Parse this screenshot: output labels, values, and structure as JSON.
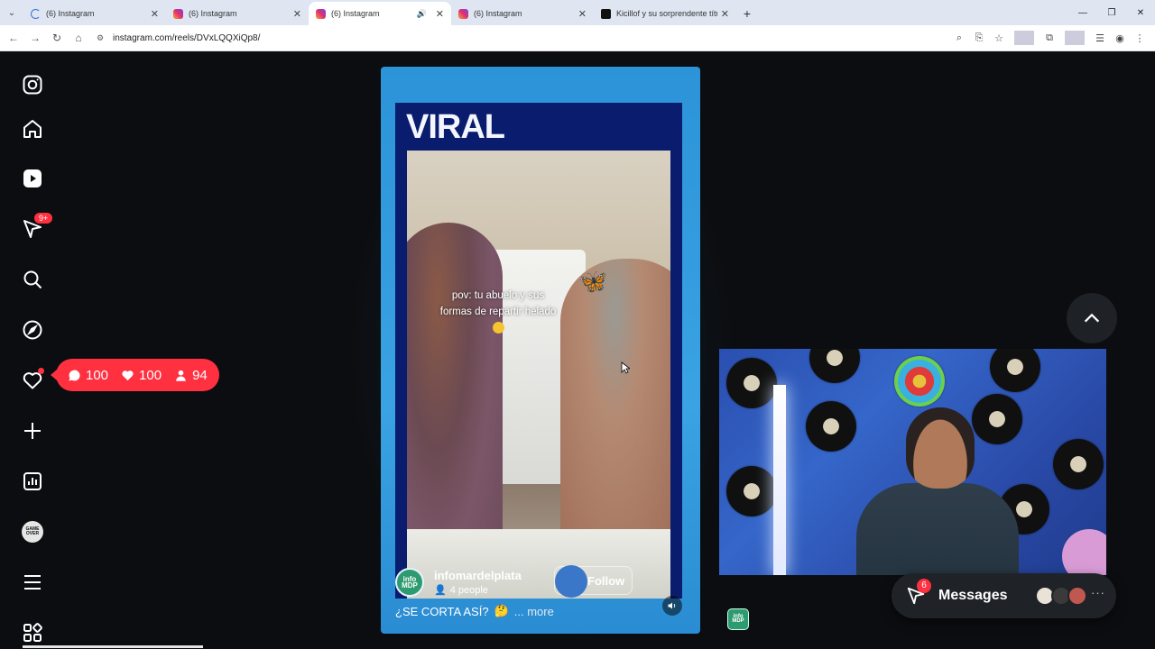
{
  "browser": {
    "tabs": [
      {
        "title": "(6) Instagram",
        "icon": "loading-icon",
        "active": false
      },
      {
        "title": "(6) Instagram",
        "icon": "instagram-icon",
        "active": false
      },
      {
        "title": "(6) Instagram",
        "icon": "instagram-icon",
        "active": true,
        "audio": true
      },
      {
        "title": "(6) Instagram",
        "icon": "instagram-icon",
        "active": false
      },
      {
        "title": "Kicillof y su sorprendente títul",
        "icon": "tiktok-icon",
        "active": false
      }
    ],
    "url": "instagram.com/reels/DVxLQQXiQp8/"
  },
  "sidebar": {
    "notifications_badge": "9+"
  },
  "notification_pill": {
    "comments": "100",
    "likes": "100",
    "followers": "94"
  },
  "reel": {
    "banner_text": "VIRAL",
    "overlay_text_line1": "pov: tu abuelo y sus",
    "overlay_text_line2": "formas de repartir helado",
    "author": "infomardelplata",
    "people": "4 people",
    "author_avatar_text": "info MDP",
    "follow_label": "Follow",
    "caption": "¿SE CORTA ASÍ?",
    "more_label": "... more"
  },
  "messages": {
    "label": "Messages",
    "badge": "6"
  },
  "colors": {
    "accent_red": "#ff3040",
    "reel_blue": "#2c93d8",
    "page_bg": "#0b0d10"
  }
}
